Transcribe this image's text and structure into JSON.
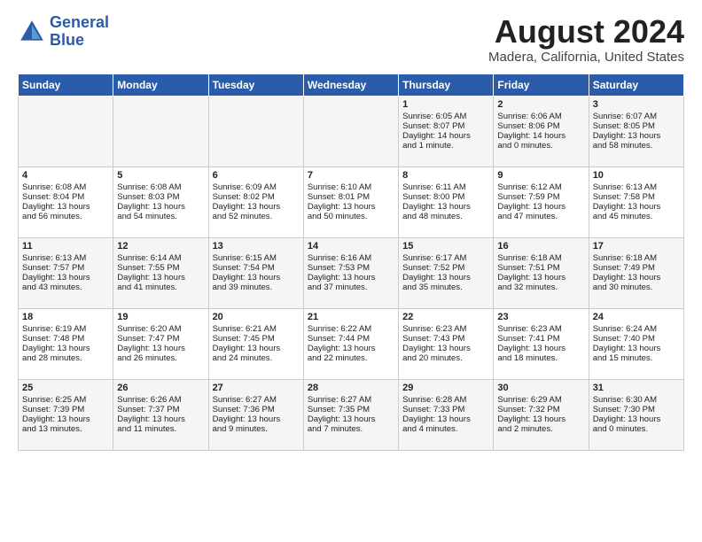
{
  "header": {
    "logo_line1": "General",
    "logo_line2": "Blue",
    "main_title": "August 2024",
    "sub_title": "Madera, California, United States"
  },
  "days_of_week": [
    "Sunday",
    "Monday",
    "Tuesday",
    "Wednesday",
    "Thursday",
    "Friday",
    "Saturday"
  ],
  "weeks": [
    [
      {
        "day": "",
        "info": ""
      },
      {
        "day": "",
        "info": ""
      },
      {
        "day": "",
        "info": ""
      },
      {
        "day": "",
        "info": ""
      },
      {
        "day": "1",
        "info": "Sunrise: 6:05 AM\nSunset: 8:07 PM\nDaylight: 14 hours\nand 1 minute."
      },
      {
        "day": "2",
        "info": "Sunrise: 6:06 AM\nSunset: 8:06 PM\nDaylight: 14 hours\nand 0 minutes."
      },
      {
        "day": "3",
        "info": "Sunrise: 6:07 AM\nSunset: 8:05 PM\nDaylight: 13 hours\nand 58 minutes."
      }
    ],
    [
      {
        "day": "4",
        "info": "Sunrise: 6:08 AM\nSunset: 8:04 PM\nDaylight: 13 hours\nand 56 minutes."
      },
      {
        "day": "5",
        "info": "Sunrise: 6:08 AM\nSunset: 8:03 PM\nDaylight: 13 hours\nand 54 minutes."
      },
      {
        "day": "6",
        "info": "Sunrise: 6:09 AM\nSunset: 8:02 PM\nDaylight: 13 hours\nand 52 minutes."
      },
      {
        "day": "7",
        "info": "Sunrise: 6:10 AM\nSunset: 8:01 PM\nDaylight: 13 hours\nand 50 minutes."
      },
      {
        "day": "8",
        "info": "Sunrise: 6:11 AM\nSunset: 8:00 PM\nDaylight: 13 hours\nand 48 minutes."
      },
      {
        "day": "9",
        "info": "Sunrise: 6:12 AM\nSunset: 7:59 PM\nDaylight: 13 hours\nand 47 minutes."
      },
      {
        "day": "10",
        "info": "Sunrise: 6:13 AM\nSunset: 7:58 PM\nDaylight: 13 hours\nand 45 minutes."
      }
    ],
    [
      {
        "day": "11",
        "info": "Sunrise: 6:13 AM\nSunset: 7:57 PM\nDaylight: 13 hours\nand 43 minutes."
      },
      {
        "day": "12",
        "info": "Sunrise: 6:14 AM\nSunset: 7:55 PM\nDaylight: 13 hours\nand 41 minutes."
      },
      {
        "day": "13",
        "info": "Sunrise: 6:15 AM\nSunset: 7:54 PM\nDaylight: 13 hours\nand 39 minutes."
      },
      {
        "day": "14",
        "info": "Sunrise: 6:16 AM\nSunset: 7:53 PM\nDaylight: 13 hours\nand 37 minutes."
      },
      {
        "day": "15",
        "info": "Sunrise: 6:17 AM\nSunset: 7:52 PM\nDaylight: 13 hours\nand 35 minutes."
      },
      {
        "day": "16",
        "info": "Sunrise: 6:18 AM\nSunset: 7:51 PM\nDaylight: 13 hours\nand 32 minutes."
      },
      {
        "day": "17",
        "info": "Sunrise: 6:18 AM\nSunset: 7:49 PM\nDaylight: 13 hours\nand 30 minutes."
      }
    ],
    [
      {
        "day": "18",
        "info": "Sunrise: 6:19 AM\nSunset: 7:48 PM\nDaylight: 13 hours\nand 28 minutes."
      },
      {
        "day": "19",
        "info": "Sunrise: 6:20 AM\nSunset: 7:47 PM\nDaylight: 13 hours\nand 26 minutes."
      },
      {
        "day": "20",
        "info": "Sunrise: 6:21 AM\nSunset: 7:45 PM\nDaylight: 13 hours\nand 24 minutes."
      },
      {
        "day": "21",
        "info": "Sunrise: 6:22 AM\nSunset: 7:44 PM\nDaylight: 13 hours\nand 22 minutes."
      },
      {
        "day": "22",
        "info": "Sunrise: 6:23 AM\nSunset: 7:43 PM\nDaylight: 13 hours\nand 20 minutes."
      },
      {
        "day": "23",
        "info": "Sunrise: 6:23 AM\nSunset: 7:41 PM\nDaylight: 13 hours\nand 18 minutes."
      },
      {
        "day": "24",
        "info": "Sunrise: 6:24 AM\nSunset: 7:40 PM\nDaylight: 13 hours\nand 15 minutes."
      }
    ],
    [
      {
        "day": "25",
        "info": "Sunrise: 6:25 AM\nSunset: 7:39 PM\nDaylight: 13 hours\nand 13 minutes."
      },
      {
        "day": "26",
        "info": "Sunrise: 6:26 AM\nSunset: 7:37 PM\nDaylight: 13 hours\nand 11 minutes."
      },
      {
        "day": "27",
        "info": "Sunrise: 6:27 AM\nSunset: 7:36 PM\nDaylight: 13 hours\nand 9 minutes."
      },
      {
        "day": "28",
        "info": "Sunrise: 6:27 AM\nSunset: 7:35 PM\nDaylight: 13 hours\nand 7 minutes."
      },
      {
        "day": "29",
        "info": "Sunrise: 6:28 AM\nSunset: 7:33 PM\nDaylight: 13 hours\nand 4 minutes."
      },
      {
        "day": "30",
        "info": "Sunrise: 6:29 AM\nSunset: 7:32 PM\nDaylight: 13 hours\nand 2 minutes."
      },
      {
        "day": "31",
        "info": "Sunrise: 6:30 AM\nSunset: 7:30 PM\nDaylight: 13 hours\nand 0 minutes."
      }
    ]
  ]
}
